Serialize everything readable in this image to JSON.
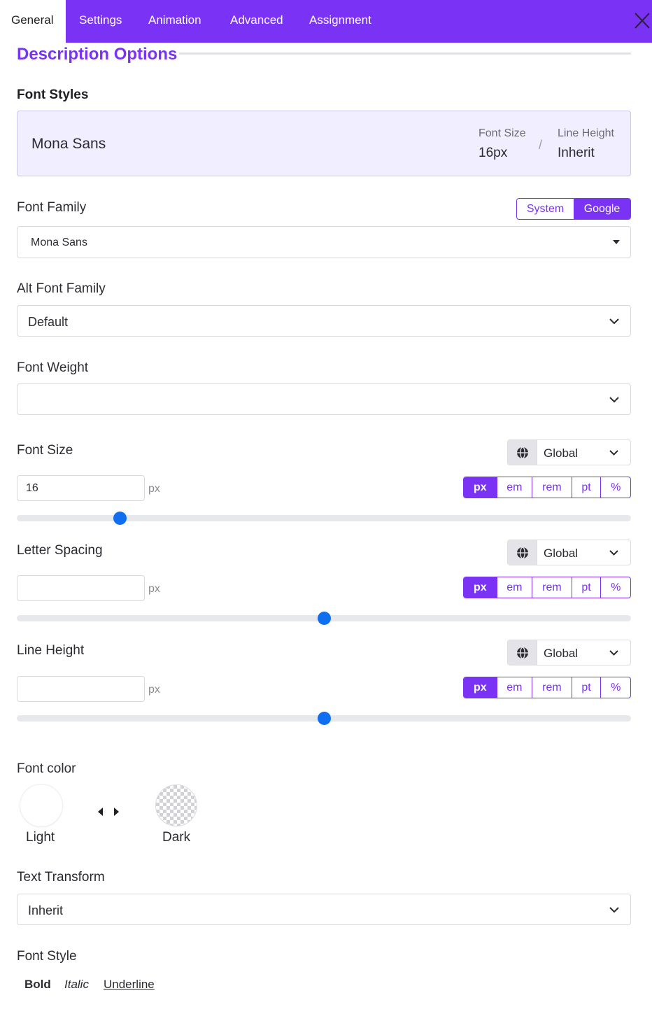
{
  "tabs": [
    {
      "label": "General",
      "active": true
    },
    {
      "label": "Settings"
    },
    {
      "label": "Animation"
    },
    {
      "label": "Advanced"
    },
    {
      "label": "Assignment"
    }
  ],
  "close_icon": "close-icon",
  "section": {
    "title": "Description Options"
  },
  "font_styles": {
    "label": "Font Styles",
    "preview": {
      "font_name": "Mona Sans",
      "font_size_label": "Font Size",
      "font_size_value": "16px",
      "separator": "/",
      "line_height_label": "Line Height",
      "line_height_value": "Inherit"
    }
  },
  "font_family": {
    "label": "Font Family",
    "source_options": [
      "System",
      "Google"
    ],
    "source_selected": "Google",
    "value": "Mona Sans"
  },
  "alt_font_family": {
    "label": "Alt Font Family",
    "value": "Default"
  },
  "font_weight": {
    "label": "Font Weight",
    "value": ""
  },
  "font_size": {
    "label": "Font Size",
    "scope": "Global",
    "value": "16",
    "unit_suffix": "px",
    "units": [
      "px",
      "em",
      "rem",
      "pt",
      "%"
    ],
    "unit_selected": "px",
    "slider_fraction": 0.167
  },
  "letter_spacing": {
    "label": "Letter Spacing",
    "scope": "Global",
    "value": "",
    "unit_suffix": "px",
    "units": [
      "px",
      "em",
      "rem",
      "pt",
      "%"
    ],
    "unit_selected": "px",
    "slider_fraction": 0.5
  },
  "line_height": {
    "label": "Line Height",
    "scope": "Global",
    "value": "",
    "unit_suffix": "px",
    "units": [
      "px",
      "em",
      "rem",
      "pt",
      "%"
    ],
    "unit_selected": "px",
    "slider_fraction": 0.5
  },
  "font_color": {
    "label": "Font color",
    "light_label": "Light",
    "dark_label": "Dark",
    "light_color": "#ffffff",
    "dark_color": "transparent"
  },
  "text_transform": {
    "label": "Text Transform",
    "value": "Inherit"
  },
  "font_style": {
    "label": "Font Style",
    "options": [
      "Bold",
      "Italic",
      "Underline"
    ]
  },
  "colors": {
    "accent": "#7a33f5",
    "slider_thumb": "#0f6ff0"
  }
}
